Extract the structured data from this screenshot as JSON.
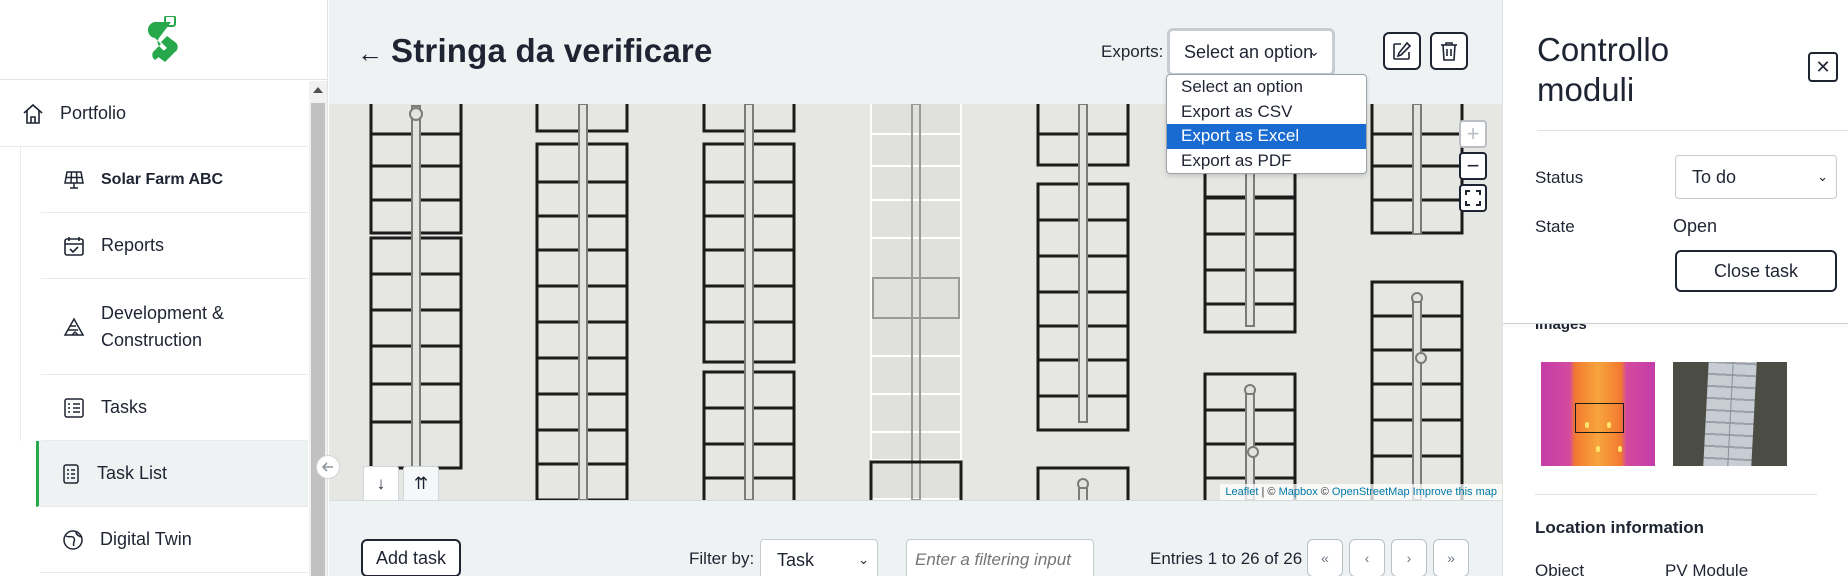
{
  "sidebar": {
    "items": [
      {
        "label": "Portfolio",
        "icon": "home-icon"
      },
      {
        "label": "Solar Farm ABC",
        "icon": "solar-panel-icon"
      },
      {
        "label": "Reports",
        "icon": "calendar-check-icon"
      },
      {
        "label": "Development & Construction",
        "icon": "construction-icon"
      },
      {
        "label": "Tasks",
        "icon": "task-list-icon"
      },
      {
        "label": "Task List",
        "icon": "checklist-icon"
      },
      {
        "label": "Digital Twin",
        "icon": "globe-icon"
      }
    ],
    "accent_color": "#27a84a"
  },
  "header": {
    "back_arrow": "←",
    "title": "Stringa da verificare",
    "exports_label": "Exports:",
    "exports_selected": "Select an option",
    "exports_options": [
      "Select an option",
      "Export as CSV",
      "Export as Excel",
      "Export as PDF"
    ],
    "highlighted_option": "Export as Excel"
  },
  "map": {
    "zoom_in": "+",
    "zoom_out": "−",
    "attribution": {
      "leaflet": "Leaflet",
      "sep1": " | © ",
      "mapbox": "Mapbox",
      "sep2": " © ",
      "osm": "OpenStreetMap",
      "improve": " Improve this map"
    },
    "tabs": [
      "↓",
      "⇈"
    ]
  },
  "toolbar": {
    "add_task": "Add task",
    "filter_label": "Filter by:",
    "filter_selected": "Task",
    "filter_placeholder": "Enter a filtering input",
    "entries_text": "Entries 1 to 26 of 26",
    "pagination": [
      "«",
      "‹",
      "›",
      "»"
    ]
  },
  "right_panel": {
    "title": "Controllo moduli",
    "close": "✕",
    "status_label": "Status",
    "status_value": "To do",
    "state_label": "State",
    "state_value": "Open",
    "close_task": "Close task",
    "images_label": "Images",
    "location_heading": "Location information",
    "object_label": "Object",
    "object_value": "PV Module"
  }
}
